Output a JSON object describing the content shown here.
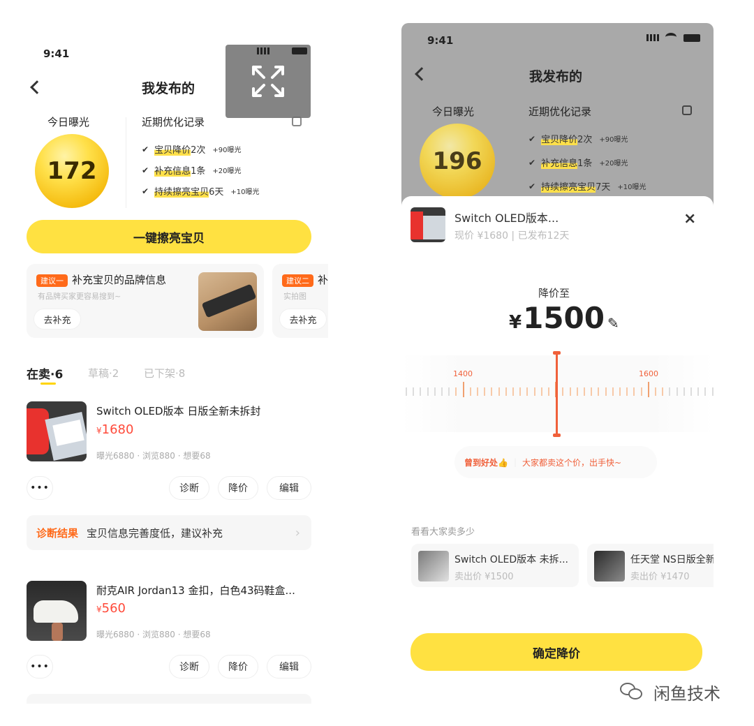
{
  "left": {
    "status_time": "9:41",
    "nav_title": "我发布的",
    "exposure_label": "今日曝光",
    "exposure_value": "172",
    "records_label": "近期优化记录",
    "records": [
      {
        "highlight": "宝贝降价",
        "rest": "2次",
        "bonus": "+90曝光"
      },
      {
        "highlight": "补充信息",
        "rest": "1条",
        "bonus": "+20曝光"
      },
      {
        "highlight": "持续擦亮宝贝",
        "rest": "6天",
        "bonus": "+10曝光"
      }
    ],
    "polish_button": "一键擦亮宝贝",
    "suggestions": [
      {
        "tag": "建议一",
        "title": "补充宝贝的品牌信息",
        "desc": "有品牌买家更容易搜到~",
        "action": "去补充"
      },
      {
        "tag": "建议二",
        "title": "补",
        "desc": "实拍图",
        "action": "去补充"
      }
    ],
    "tabs": [
      {
        "label": "在卖·6",
        "active": true
      },
      {
        "label": "草稿·2",
        "active": false
      },
      {
        "label": "已下架·8",
        "active": false
      }
    ],
    "items": [
      {
        "title": "Switch OLED版本 日版全新未拆封",
        "currency": "¥",
        "price": "1680",
        "stats": "曝光6880 · 浏览880 · 想要68"
      },
      {
        "title": "耐克AIR Jordan13 金扣，白色43码鞋盒...",
        "currency": "¥",
        "price": "560",
        "stats": "曝光6880 · 浏览880 · 想要68"
      }
    ],
    "actions": {
      "more": "•••",
      "diagnose": "诊断",
      "reduce": "降价",
      "edit": "编辑"
    },
    "diagnosis": {
      "label": "诊断结果",
      "text": "宝贝信息完善度低，建议补充",
      "arrow": "›"
    }
  },
  "right": {
    "status_time": "9:41",
    "nav_title": "我发布的",
    "exposure_label": "今日曝光",
    "exposure_value": "196",
    "records_label": "近期优化记录",
    "records": [
      {
        "highlight": "宝贝降价",
        "rest": "2次",
        "bonus": "+90曝光"
      },
      {
        "highlight": "补充信息",
        "rest": "1条",
        "bonus": "+20曝光"
      },
      {
        "highlight": "持续擦亮宝贝",
        "rest": "7天",
        "bonus": "+10曝光"
      }
    ],
    "sheet": {
      "item_title": "Switch OLED版本...",
      "item_sub": "现价 ¥1680 | 已发布12天",
      "close": "×",
      "reduce_label": "降价至",
      "currency": "¥",
      "price": "1500",
      "ruler_labels": [
        "1400",
        "1600"
      ],
      "hint_left": "曾到好处👍",
      "hint_right": "大家都卖这个价，出手快~",
      "compare_title": "看看大家卖多少",
      "compare": [
        {
          "title": "Switch OLED版本 未拆...",
          "price": "卖出价 ¥1500"
        },
        {
          "title": "任天堂 NS日版全新",
          "price": "卖出价 ¥1470"
        }
      ],
      "confirm": "确定降价"
    }
  },
  "watermark": "闲鱼技术",
  "colors": {
    "yellow": "#ffe141",
    "orange": "#ff6a1a",
    "price_red": "#ff4a3a",
    "ruler": "#f0603a"
  }
}
